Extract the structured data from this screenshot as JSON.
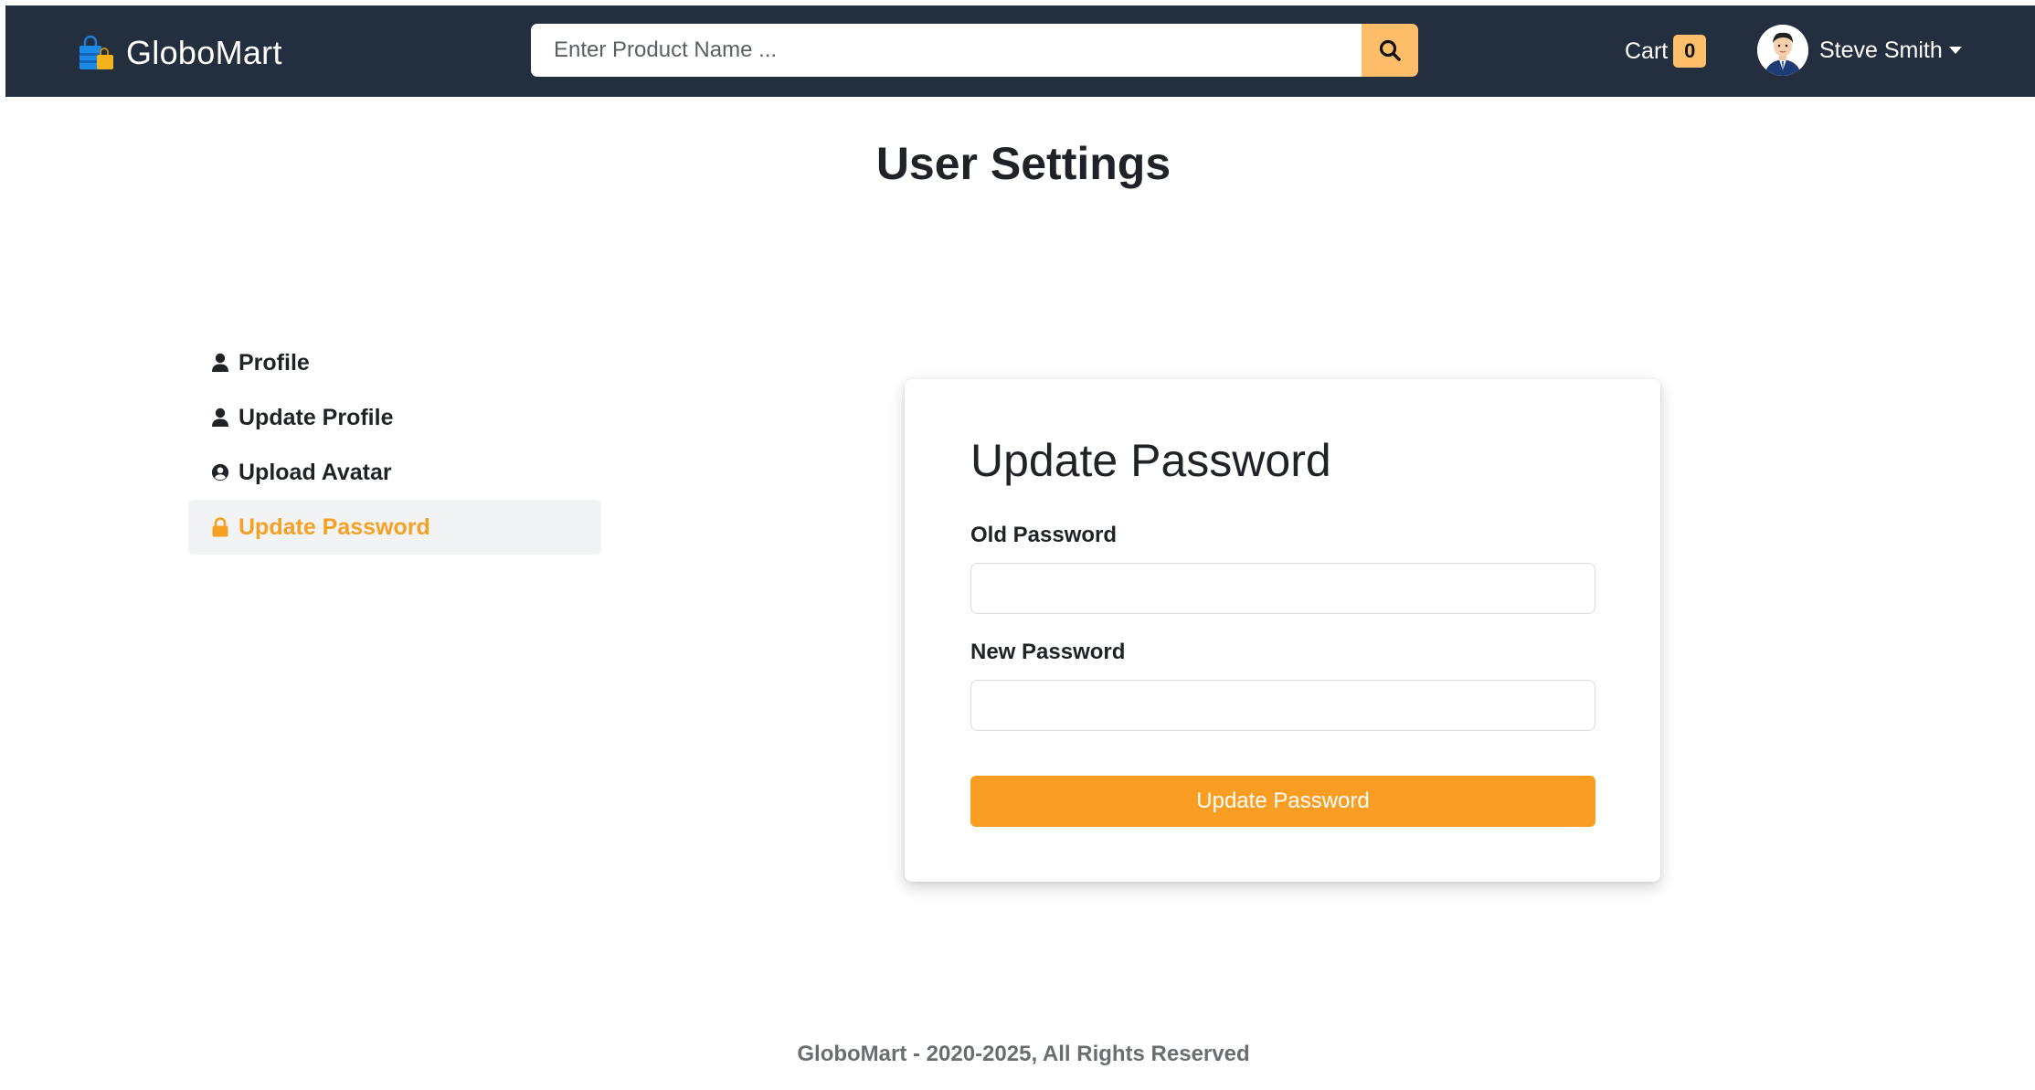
{
  "navbar": {
    "brand_name": "GloboMart",
    "search": {
      "placeholder": "Enter Product Name ...",
      "value": ""
    },
    "cart": {
      "label": "Cart",
      "count": "0"
    },
    "user": {
      "name": "Steve Smith"
    },
    "colors": {
      "bg": "#232f3e",
      "accent": "#febd69"
    }
  },
  "page": {
    "title": "User Settings"
  },
  "sidebar": {
    "items": [
      {
        "label": "Profile",
        "icon": "user-icon",
        "active": false
      },
      {
        "label": "Update Profile",
        "icon": "user-icon",
        "active": false
      },
      {
        "label": "Upload Avatar",
        "icon": "user-circle-icon",
        "active": false
      },
      {
        "label": "Update Password",
        "icon": "lock-icon",
        "active": true
      }
    ]
  },
  "form": {
    "title": "Update Password",
    "old_password": {
      "label": "Old Password",
      "value": ""
    },
    "new_password": {
      "label": "New Password",
      "value": ""
    },
    "submit_label": "Update Password",
    "accent": "#f99d23"
  },
  "footer": {
    "text": "GloboMart - 2020-2025, All Rights Reserved"
  }
}
